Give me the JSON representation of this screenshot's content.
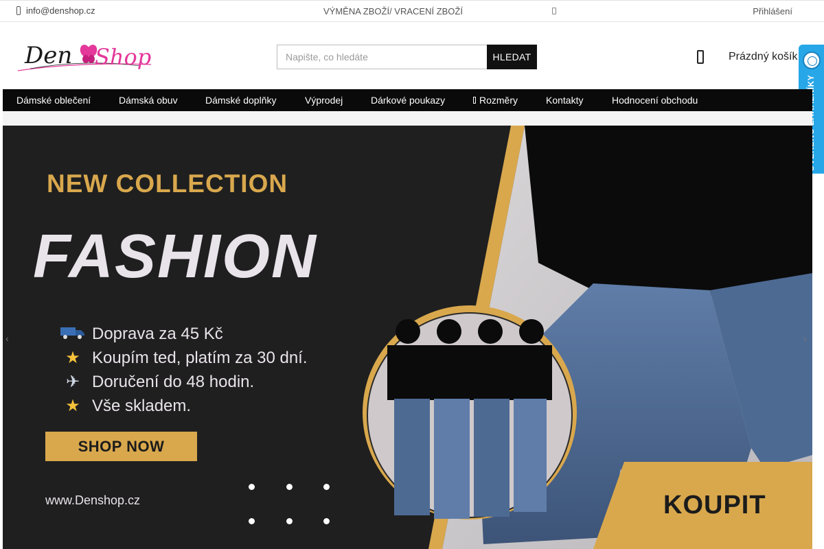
{
  "topbar": {
    "email": "info@denshop.cz",
    "exchange_link": "VÝMĚNA ZBOŽÍ/ VRACENÍ ZBOŽÍ",
    "login": "Přihlášení"
  },
  "header": {
    "logo_text_den": "Den",
    "logo_text_shop": "Shop",
    "search_placeholder": "Napište, co hledáte",
    "search_button": "HLEDAT",
    "cart_label": "Prázdný košík"
  },
  "trust_badge": {
    "text": "OVĚŘENO ZÁKAZNÍKY"
  },
  "nav": {
    "items": [
      {
        "label": "Dámské oblečení"
      },
      {
        "label": "Dámská obuv"
      },
      {
        "label": "Dámské doplňky"
      },
      {
        "label": "Výprodej"
      },
      {
        "label": "Dárkové poukazy"
      },
      {
        "label": "Rozměry"
      },
      {
        "label": "Kontakty"
      },
      {
        "label": "Hodnocení obchodu"
      }
    ]
  },
  "hero": {
    "headline_small": "NEW COLLECTION",
    "headline_big": "FASHION",
    "features": [
      {
        "icon": "truck-icon",
        "text": "Doprava za 45 Kč"
      },
      {
        "icon": "star-icon",
        "text": "Koupím ted, platím za 30 dní."
      },
      {
        "icon": "airplane-icon",
        "text": "Doručení do 48 hodin."
      },
      {
        "icon": "star-icon",
        "text": "Vše skladem."
      }
    ],
    "cta": "SHOP NOW",
    "website": "www.Denshop.cz",
    "buy_label": "KOUPIT"
  },
  "colors": {
    "accent_gold": "#d9a84d",
    "nav_bg": "#0a0a0a",
    "logo_pink": "#e4389a",
    "badge_blue": "#27a7e7"
  }
}
